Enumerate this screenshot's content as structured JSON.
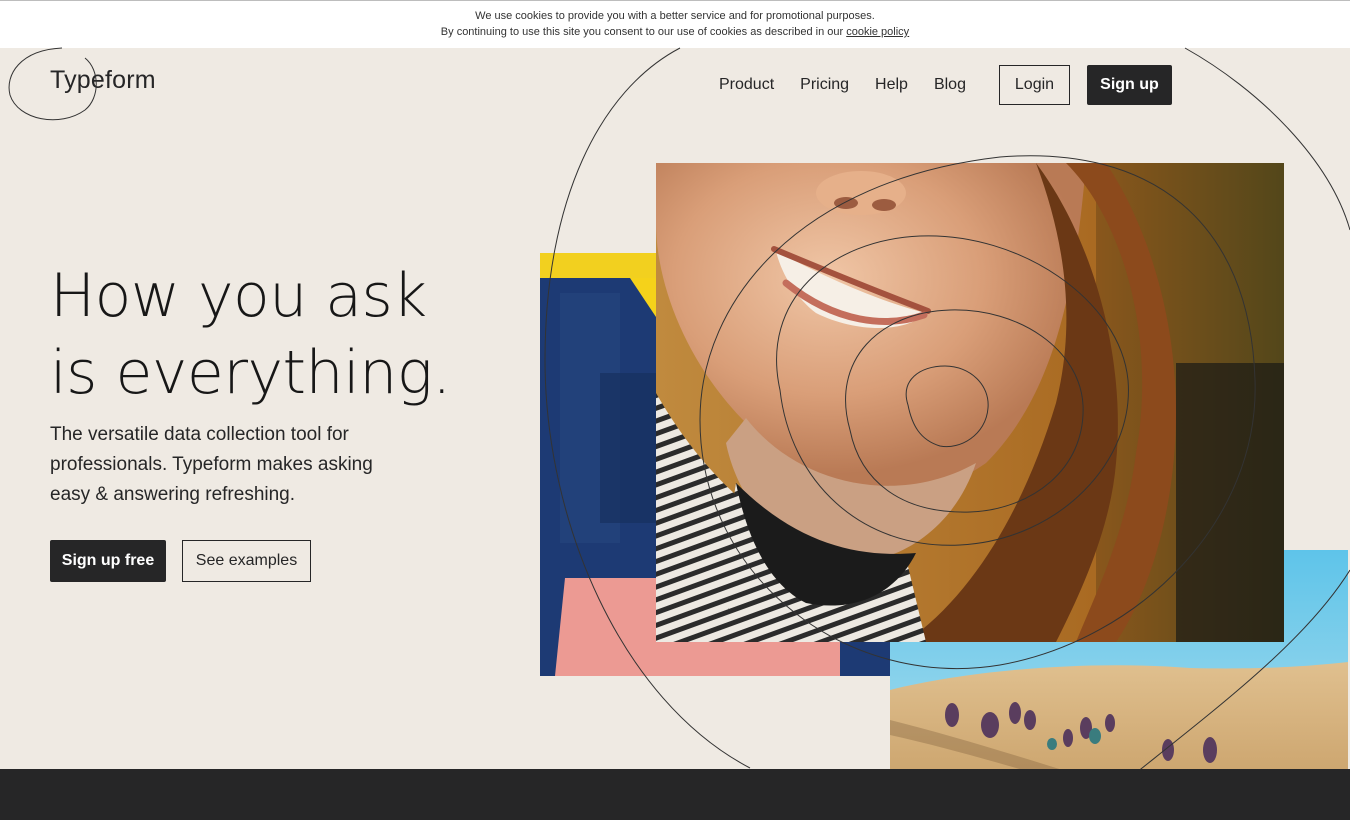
{
  "cookie_banner": {
    "line1": "We use cookies to provide you with a better service and for promotional purposes.",
    "line2": "By continuing to use this site you consent to our use of cookies as described in our",
    "link": "cookie policy"
  },
  "brand": {
    "name": "Typeform"
  },
  "nav": {
    "links": [
      "Product",
      "Pricing",
      "Help",
      "Blog"
    ],
    "login": "Login",
    "signup": "Sign up"
  },
  "hero": {
    "headline_line1": "How you ask",
    "headline_line2": "is everything.",
    "subtext": "The versatile data collection tool for professionals. Typeform makes asking easy & answering refreshing.",
    "cta_primary": "Sign up free",
    "cta_secondary": "See examples"
  },
  "colors": {
    "background": "#efeae3",
    "dark": "#262627",
    "cookie_bar": "#ffffff"
  }
}
